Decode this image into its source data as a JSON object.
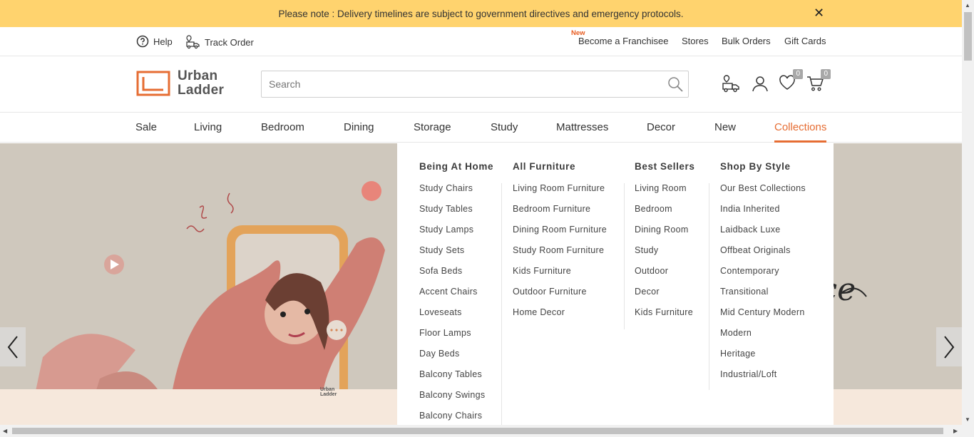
{
  "notice": {
    "text": "Please note : Delivery timelines are subject to government directives and emergency protocols.",
    "close": "✕"
  },
  "utility": {
    "help": "Help",
    "track_order": "Track Order",
    "new_tag": "New",
    "links": [
      "Become a Franchisee",
      "Stores",
      "Bulk Orders",
      "Gift Cards"
    ]
  },
  "header": {
    "logo_line1": "Urban",
    "logo_line2": "Ladder",
    "search_placeholder": "Search",
    "wishlist_count": "0",
    "cart_count": "0"
  },
  "nav": {
    "items": [
      "Sale",
      "Living",
      "Bedroom",
      "Dining",
      "Storage",
      "Study",
      "Mattresses",
      "Decor",
      "New",
      "Collections"
    ],
    "active": "Collections"
  },
  "mega_menu": {
    "columns": [
      {
        "title": "Being At Home",
        "items": [
          "Study Chairs",
          "Study Tables",
          "Study Lamps",
          "Study Sets",
          "Sofa Beds",
          "Accent Chairs",
          "Loveseats",
          "Floor Lamps",
          "Day Beds",
          "Balcony Tables",
          "Balcony Swings",
          "Balcony Chairs"
        ]
      },
      {
        "title": "All Furniture",
        "items": [
          "Living Room Furniture",
          "Bedroom Furniture",
          "Dining Room Furniture",
          "Study Room Furniture",
          "Kids Furniture",
          "Outdoor Furniture",
          "Home Decor"
        ]
      },
      {
        "title": "Best Sellers",
        "items": [
          "Living Room",
          "Bedroom",
          "Dining Room",
          "Study",
          "Outdoor",
          "Decor",
          "Kids Furniture"
        ]
      },
      {
        "title": "Shop By Style",
        "items": [
          "Our Best Collections",
          "India Inherited",
          "Laidback Luxe",
          "Offbeat Originals",
          "Contemporary",
          "Transitional",
          "Mid Century Modern",
          "Modern",
          "Heritage",
          "Industrial/Loft"
        ]
      }
    ]
  },
  "hero": {
    "phone_logo_line1": "Urban",
    "phone_logo_line2": "Ladder",
    "script_text": "experience"
  },
  "colors": {
    "accent": "#e66d33",
    "notice_bg": "#ffd36e"
  }
}
